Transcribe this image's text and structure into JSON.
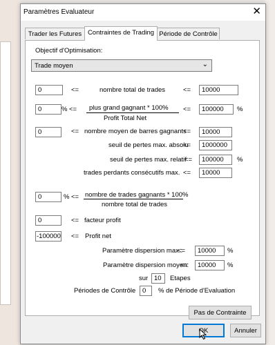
{
  "dialog": {
    "title": "Paramètres Evaluateur",
    "close_icon": "close-icon"
  },
  "tabs": [
    {
      "label": "Trader les Futures",
      "active": false
    },
    {
      "label": "Contraintes de Trading",
      "active": true
    },
    {
      "label": "Période de Contrôle",
      "active": false
    }
  ],
  "objective": {
    "label": "Objectif d'Optimisation:",
    "selected": "Trade moyen"
  },
  "rows": {
    "total_trades": {
      "min": "0",
      "op1": "<=",
      "label": "nombre total de trades",
      "op2": "<=",
      "max": "10000"
    },
    "biggest_winner": {
      "min": "0",
      "unit1": "%",
      "op1": "<=",
      "numerator": "plus grand gagnant * 100%",
      "op2": "<=",
      "max": "100000",
      "unit2": "%",
      "denominator": "Profit Total Net"
    },
    "avg_bars": {
      "min": "0",
      "op1": "<=",
      "label": "nombre moyen de barres gagnants",
      "op2": "<=",
      "max": "10000"
    },
    "loss_abs": {
      "label": "seuil de pertes max. absolu",
      "op": "<=",
      "value": "1000000"
    },
    "loss_rel": {
      "label": "seuil de pertes max. relatif",
      "op": "<=",
      "value": "100000",
      "unit": "%"
    },
    "consec_losers": {
      "label": "trades perdants consécutifs max.",
      "op": "<=",
      "value": "10000"
    },
    "winning_trades": {
      "min": "0",
      "unit": "%",
      "op": "<=",
      "numerator": "nombre de trades gagnants * 100%",
      "denominator": "nombre total de trades"
    },
    "profit_factor": {
      "min": "0",
      "op": "<=",
      "label": "facteur profit"
    },
    "net_profit": {
      "min": "-100000(",
      "op": "<=",
      "label": "Profit net"
    },
    "disp_max": {
      "label": "Paramètre dispersion max.:",
      "op": "<=",
      "value": "10000",
      "unit": "%"
    },
    "disp_avg": {
      "label": "Paramètre dispersion moyen:",
      "op": "<=",
      "value": "10000",
      "unit": "%"
    },
    "steps": {
      "pre": "sur",
      "value": "10",
      "post": "Etapes"
    },
    "control": {
      "label": "Périodes de Contrôle",
      "value": "0",
      "post": "% de Période d'Evaluation"
    }
  },
  "buttons": {
    "no_constraint": "Pas de Contrainte",
    "ok": "OK",
    "cancel": "Annuler"
  }
}
